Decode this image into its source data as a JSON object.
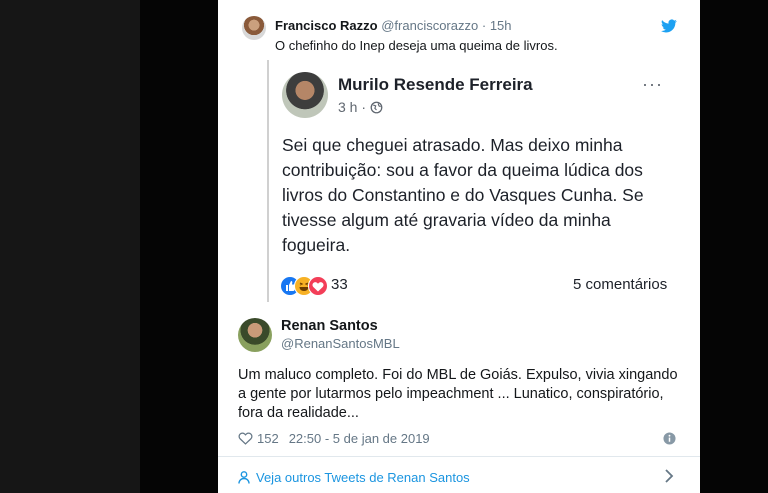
{
  "retweet": {
    "name": "Francisco Razzo",
    "handle": "@franciscorazzo",
    "time": "15h",
    "text": "O chefinho do Inep deseja uma queima de livros."
  },
  "fb_post": {
    "author": "Murilo Resende Ferreira",
    "meta": "3 h ·",
    "body": "Sei que cheguei atrasado. Mas deixo minha contribuição: sou a favor da queima lúdica dos livros do Constantino e do Vasques Cunha. Se tivesse algum até gravaria  vídeo da minha fogueira.",
    "reaction_count": "33",
    "comments": "5 comentários",
    "menu": "···"
  },
  "tweet": {
    "name": "Renan Santos",
    "handle": "@RenanSantosMBL",
    "text": "Um maluco completo. Foi do MBL de Goiás. Expulso, vivia xingando a gente por lutarmos pelo impeachment ... Lunatico, conspiratório, fora da realidade...",
    "likes": "152",
    "timestamp": "22:50 - 5 de jan de 2019"
  },
  "footer": {
    "more_link": "Veja outros Tweets de Renan Santos"
  },
  "colors": {
    "twitter_blue": "#1da1f2",
    "link_blue": "#1b95e0",
    "text_dark": "#14171a",
    "text_muted": "#657786"
  },
  "icons": [
    "twitter-bird-icon",
    "globe-icon",
    "like-reaction-icon",
    "haha-reaction-icon",
    "love-reaction-icon",
    "heart-icon",
    "info-icon",
    "person-icon",
    "chevron-right-icon"
  ]
}
